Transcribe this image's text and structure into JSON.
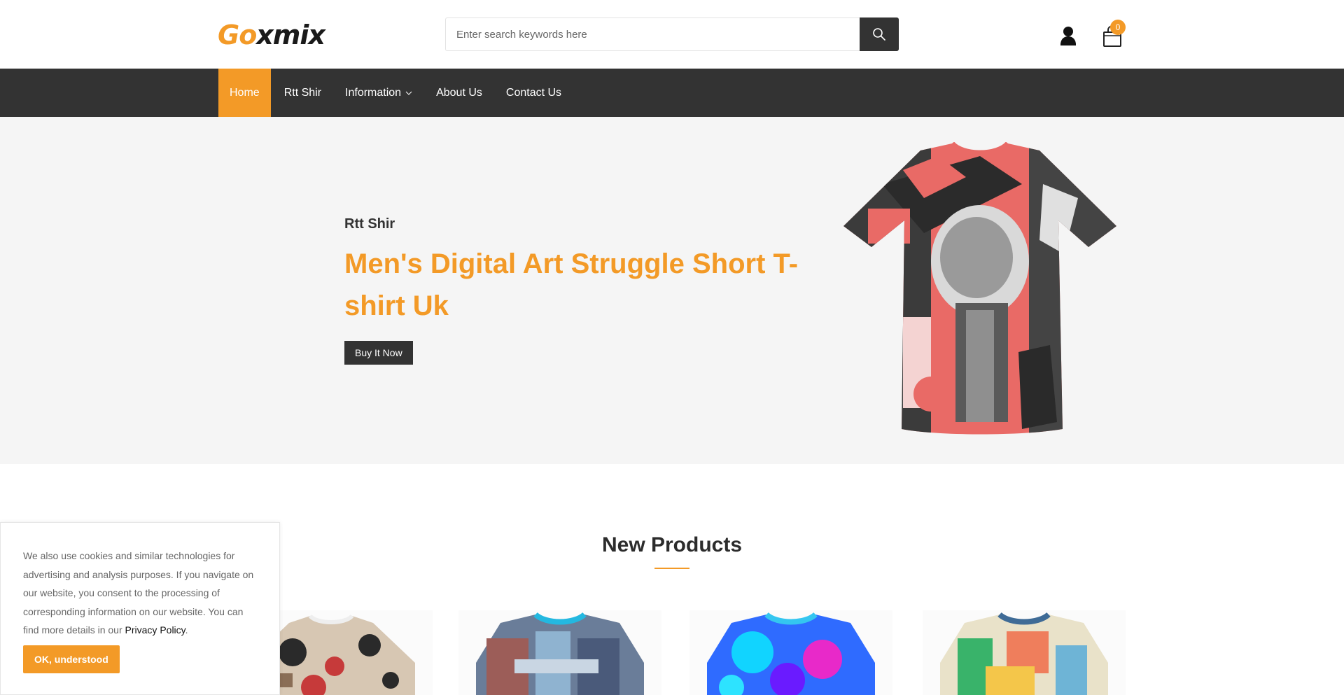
{
  "brand": {
    "logo_part1": "Go",
    "logo_part2": "xmix"
  },
  "search": {
    "placeholder": "Enter search keywords here"
  },
  "header_icons": {
    "user": "user-icon",
    "cart": "shopping-bag-icon",
    "cart_count": "0",
    "search": "search-icon"
  },
  "nav": {
    "items": [
      {
        "label": "Home",
        "active": true
      },
      {
        "label": "Rtt Shir"
      },
      {
        "label": "Information",
        "has_dropdown": true
      },
      {
        "label": "About Us"
      },
      {
        "label": "Contact Us"
      }
    ]
  },
  "hero": {
    "subtitle": "Rtt Shir",
    "title": "Men's Digital Art Struggle Short T-shirt Uk",
    "button": "Buy It Now"
  },
  "new_products": {
    "title": "New Products"
  },
  "cookie": {
    "text": "We also use cookies and similar technologies for advertising and analysis purposes. If you navigate on our website, you consent to the processing of corresponding information on our website. You can find more details in our ",
    "link": "Privacy Policy",
    "after": ".",
    "button": "OK, understood"
  },
  "colors": {
    "accent": "#f39a27",
    "dark": "#333333"
  }
}
